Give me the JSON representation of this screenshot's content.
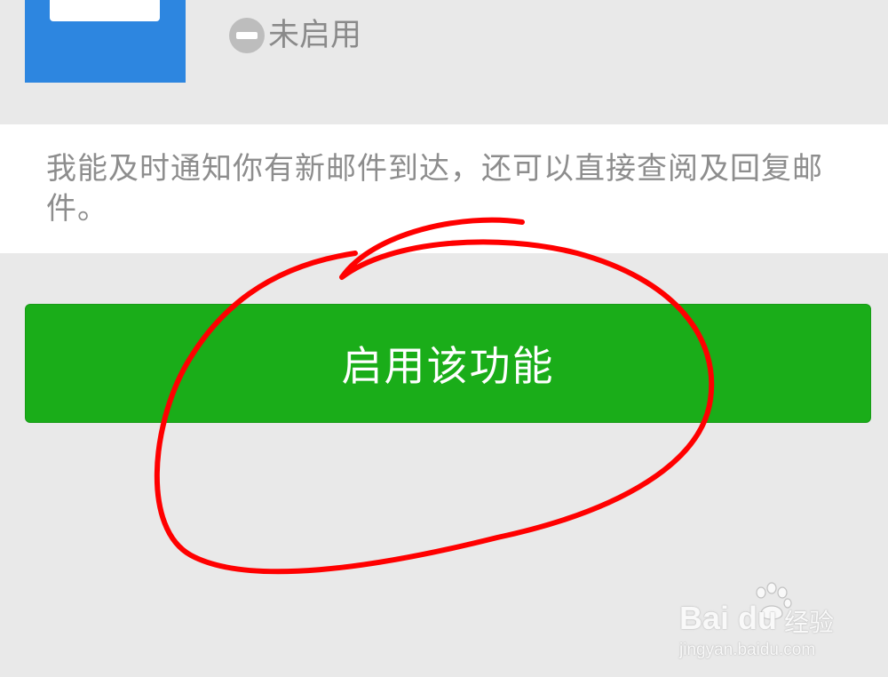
{
  "header": {
    "status_text": "未启用"
  },
  "description": {
    "text": "我能及时通知你有新邮件到达，还可以直接查阅及回复邮件。"
  },
  "actions": {
    "enable_label": "启用该功能"
  },
  "watermark": {
    "brand": "Bai du",
    "product": "经验",
    "url": "jingyan.baidu.com"
  },
  "colors": {
    "button_green": "#1aad19",
    "icon_blue": "#2d86e0",
    "annotation_red": "#ff0000"
  },
  "icons": {
    "app": "mail-envelope-icon",
    "status": "disabled-minus-icon",
    "watermark": "baidu-paw-icon"
  }
}
